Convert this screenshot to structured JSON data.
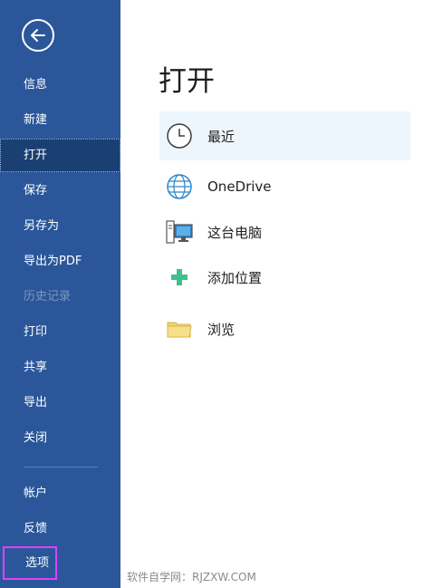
{
  "sidebar": {
    "items": [
      {
        "label": "信息"
      },
      {
        "label": "新建"
      },
      {
        "label": "打开"
      },
      {
        "label": "保存"
      },
      {
        "label": "另存为"
      },
      {
        "label": "导出为PDF"
      },
      {
        "label": "历史记录"
      },
      {
        "label": "打印"
      },
      {
        "label": "共享"
      },
      {
        "label": "导出"
      },
      {
        "label": "关闭"
      },
      {
        "label": "帐户"
      },
      {
        "label": "反馈"
      },
      {
        "label": "选项"
      }
    ]
  },
  "main": {
    "title": "打开",
    "locations": [
      {
        "label": "最近",
        "icon": "clock-icon"
      },
      {
        "label": "OneDrive",
        "icon": "globe-icon"
      },
      {
        "label": "这台电脑",
        "icon": "computer-icon"
      },
      {
        "label": "添加位置",
        "icon": "plus-icon"
      },
      {
        "label": "浏览",
        "icon": "folder-icon"
      }
    ]
  },
  "footer": {
    "watermark": "软件自学网：RJZXW.COM"
  },
  "colors": {
    "sidebar_bg": "#2b579a",
    "active_item_bg": "#1a3f73",
    "highlight_border": "#e040fb",
    "selected_location_bg": "#eef6fd"
  }
}
